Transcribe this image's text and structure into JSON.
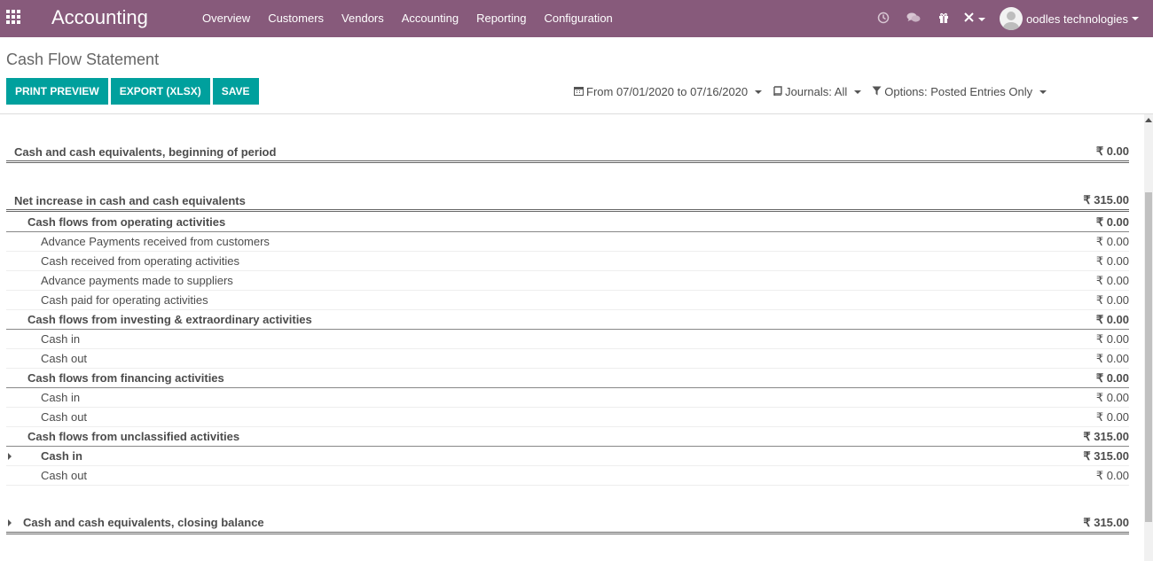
{
  "app": {
    "brand": "Accounting",
    "menu": [
      "Overview",
      "Customers",
      "Vendors",
      "Accounting",
      "Reporting",
      "Configuration"
    ],
    "systray_icons": [
      "clock-icon",
      "chat-icon",
      "gift-icon",
      "debug-icon"
    ],
    "user_name": "oodles technologies",
    "accent": "#875a7b"
  },
  "page": {
    "title": "Cash Flow Statement",
    "buttons": {
      "print_preview": "PRINT PREVIEW",
      "export_xlsx": "EXPORT (XLSX)",
      "save": "SAVE"
    },
    "button_color": "#00a09d",
    "filters": {
      "date": "From 07/01/2020 to 07/16/2020",
      "journals": "Journals: All",
      "options": "Options: Posted Entries Only"
    }
  },
  "report": {
    "rows": [
      {
        "label": "Cash and cash equivalents, beginning of period",
        "value": "₹ 0.00"
      },
      {
        "label": "Net increase in cash and cash equivalents",
        "value": "₹ 315.00"
      },
      {
        "label": "Cash flows from operating activities",
        "value": "₹ 0.00"
      },
      {
        "label": "Advance Payments received from customers",
        "value": "₹ 0.00"
      },
      {
        "label": "Cash received from operating activities",
        "value": "₹ 0.00"
      },
      {
        "label": "Advance payments made to suppliers",
        "value": "₹ 0.00"
      },
      {
        "label": "Cash paid for operating activities",
        "value": "₹ 0.00"
      },
      {
        "label": "Cash flows from investing & extraordinary activities",
        "value": "₹ 0.00"
      },
      {
        "label": "Cash in",
        "value": "₹ 0.00"
      },
      {
        "label": "Cash out",
        "value": "₹ 0.00"
      },
      {
        "label": "Cash flows from financing activities",
        "value": "₹ 0.00"
      },
      {
        "label": "Cash in",
        "value": "₹ 0.00"
      },
      {
        "label": "Cash out",
        "value": "₹ 0.00"
      },
      {
        "label": "Cash flows from unclassified activities",
        "value": "₹ 315.00"
      },
      {
        "label": "Cash in",
        "value": "₹ 315.00"
      },
      {
        "label": "Cash out",
        "value": "₹ 0.00"
      },
      {
        "label": "Cash and cash equivalents, closing balance",
        "value": "₹ 315.00"
      }
    ]
  }
}
